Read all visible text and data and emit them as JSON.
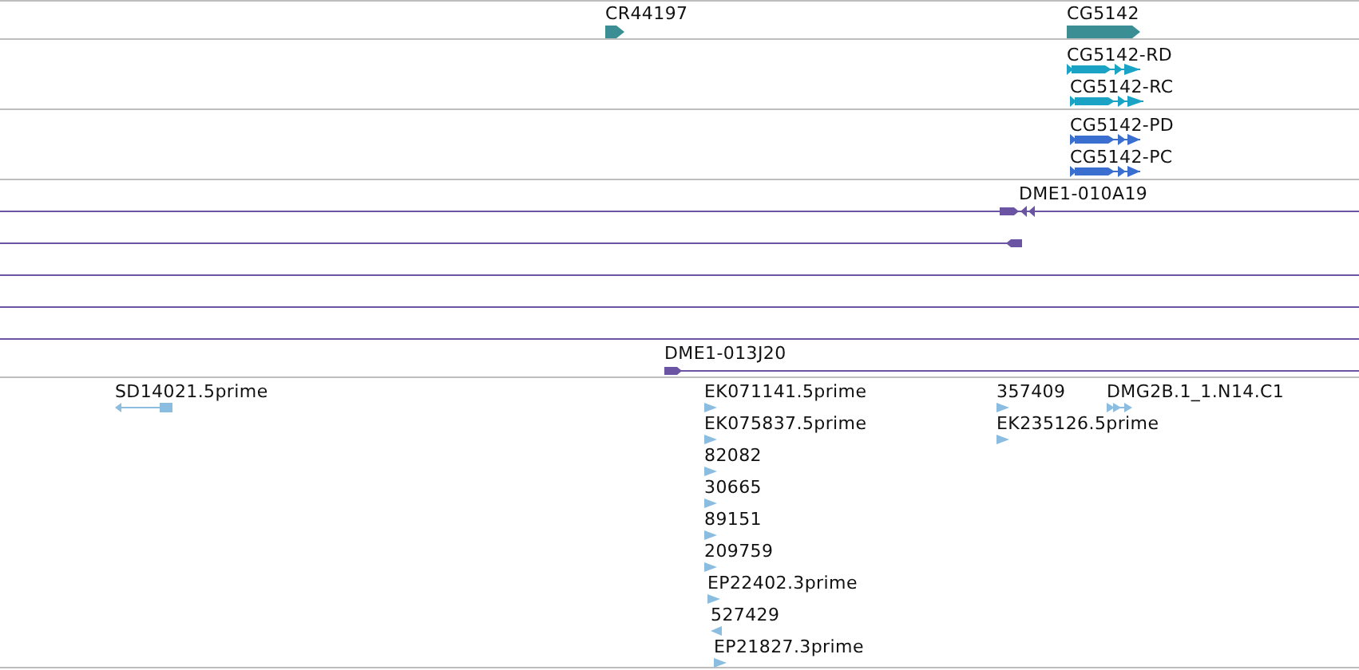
{
  "tracks": [
    {
      "kind": "gene",
      "color": "#3b8f94",
      "features": [
        {
          "label": "CR44197"
        },
        {
          "label": "CG5142"
        }
      ]
    },
    {
      "kind": "transcript",
      "color": "#1ba3c6",
      "features": [
        {
          "label": "CG5142-RD"
        },
        {
          "label": "CG5142-RC"
        }
      ]
    },
    {
      "kind": "transcript",
      "color": "#3a6fd0",
      "features": [
        {
          "label": "CG5142-PD"
        },
        {
          "label": "CG5142-PC"
        }
      ]
    },
    {
      "kind": "clone",
      "color": "#6a54a3",
      "features": [
        {
          "kind": "clone",
          "label": "DME1-010A19"
        },
        {
          "kind": "clone"
        },
        {
          "kind": "clone"
        },
        {
          "kind": "clone"
        },
        {
          "kind": "clone"
        },
        {
          "kind": "clone",
          "label": "DME1-013J20"
        }
      ]
    },
    {
      "kind": "est",
      "color": "#8bbde0",
      "features": [
        {
          "label": "SD14021.5prime"
        },
        {
          "label": "EK071141.5prime"
        },
        {
          "label": "EK075837.5prime"
        },
        {
          "label": "82082"
        },
        {
          "label": "30665"
        },
        {
          "label": "89151"
        },
        {
          "label": "209759"
        },
        {
          "label": "EP22402.3prime"
        },
        {
          "label": "527429"
        },
        {
          "label": "EP21827.3prime"
        },
        {
          "label": "357409"
        },
        {
          "label": "EK235126.5prime"
        },
        {
          "label": "DMG2B.1_1.N14.C1"
        }
      ]
    }
  ]
}
